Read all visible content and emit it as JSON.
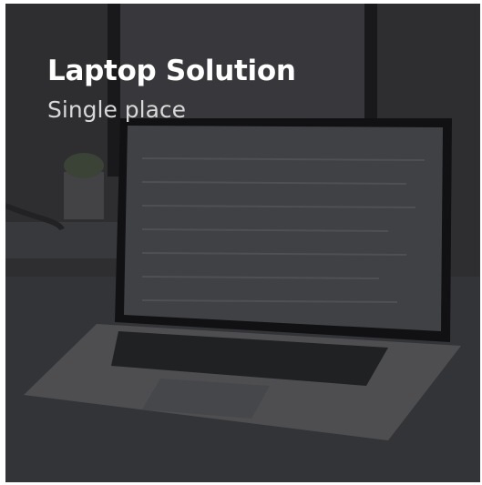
{
  "card": {
    "title": "Laptop Solution",
    "subtitle": "Single place",
    "image_subject": "laptop on desk"
  },
  "colors": {
    "overlay": "#141416",
    "title_text": "#ffffff",
    "subtitle_text": "#d8d8d8"
  }
}
